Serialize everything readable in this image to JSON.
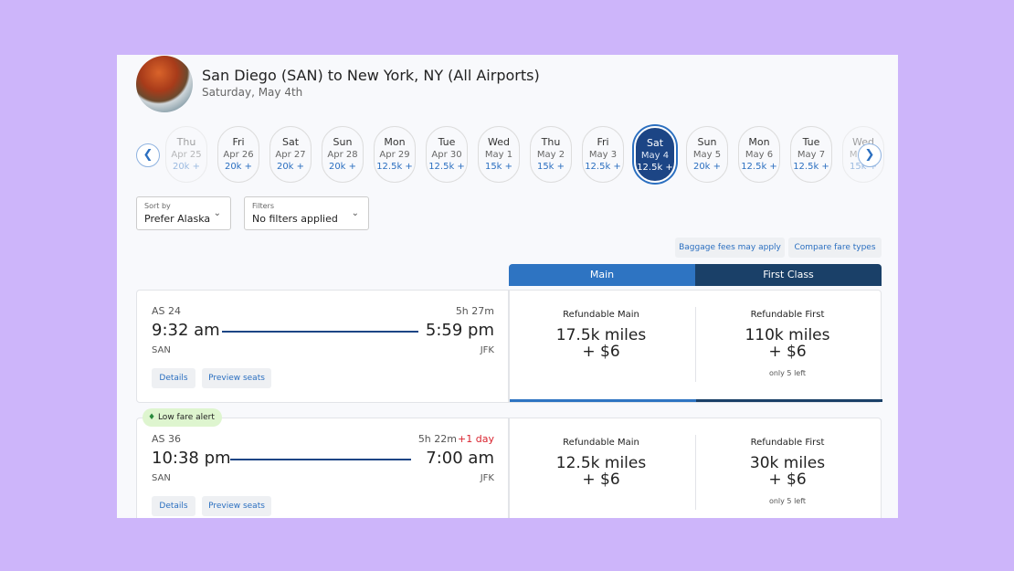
{
  "header": {
    "title": "San Diego (SAN) to New York, NY (All Airports)",
    "date": "Saturday, May 4th"
  },
  "dates": [
    {
      "day": "Thu",
      "date": "Apr 25",
      "price": "20k +"
    },
    {
      "day": "Fri",
      "date": "Apr 26",
      "price": "20k +"
    },
    {
      "day": "Sat",
      "date": "Apr 27",
      "price": "20k +"
    },
    {
      "day": "Sun",
      "date": "Apr 28",
      "price": "20k +"
    },
    {
      "day": "Mon",
      "date": "Apr 29",
      "price": "12.5k +"
    },
    {
      "day": "Tue",
      "date": "Apr 30",
      "price": "12.5k +"
    },
    {
      "day": "Wed",
      "date": "May 1",
      "price": "15k +"
    },
    {
      "day": "Thu",
      "date": "May 2",
      "price": "15k +"
    },
    {
      "day": "Fri",
      "date": "May 3",
      "price": "12.5k +"
    },
    {
      "day": "Sat",
      "date": "May 4",
      "price": "12.5k +",
      "selected": true
    },
    {
      "day": "Sun",
      "date": "May 5",
      "price": "20k +"
    },
    {
      "day": "Mon",
      "date": "May 6",
      "price": "12.5k +"
    },
    {
      "day": "Tue",
      "date": "May 7",
      "price": "12.5k +"
    },
    {
      "day": "Wed",
      "date": "May 8",
      "price": "15k +"
    }
  ],
  "sort": {
    "label": "Sort by",
    "value": "Prefer Alaska"
  },
  "filters": {
    "label": "Filters",
    "value": "No filters applied"
  },
  "links": {
    "baggage": "Baggage fees may apply",
    "compare": "Compare fare types"
  },
  "tabs": {
    "main": "Main",
    "first": "First Class"
  },
  "colors": {
    "main": "#2e74c2",
    "first": "#1a4068",
    "selected_date": "#1c4585",
    "delay": "#d9232e"
  },
  "flights": [
    {
      "number": "AS 24",
      "duration": "5h 27m",
      "extra": "",
      "depart": "9:32 am",
      "arrive": "5:59 pm",
      "from": "SAN",
      "to": "JFK",
      "details": "Details",
      "seats": "Preview seats",
      "fares": [
        {
          "name": "Refundable Main",
          "miles": "17.5k miles",
          "fee": "+ $6",
          "note": ""
        },
        {
          "name": "Refundable First",
          "miles": "110k miles",
          "fee": "+ $6",
          "note": "only 5 left"
        }
      ]
    },
    {
      "badge": "Low fare alert",
      "number": "AS 36",
      "duration": "5h 22m",
      "extra": "+1 day",
      "depart": "10:38 pm",
      "arrive": "7:00 am",
      "from": "SAN",
      "to": "JFK",
      "details": "Details",
      "seats": "Preview seats",
      "fares": [
        {
          "name": "Refundable Main",
          "miles": "12.5k miles",
          "fee": "+ $6",
          "note": ""
        },
        {
          "name": "Refundable First",
          "miles": "30k miles",
          "fee": "+ $6",
          "note": "only 5 left"
        }
      ]
    }
  ]
}
